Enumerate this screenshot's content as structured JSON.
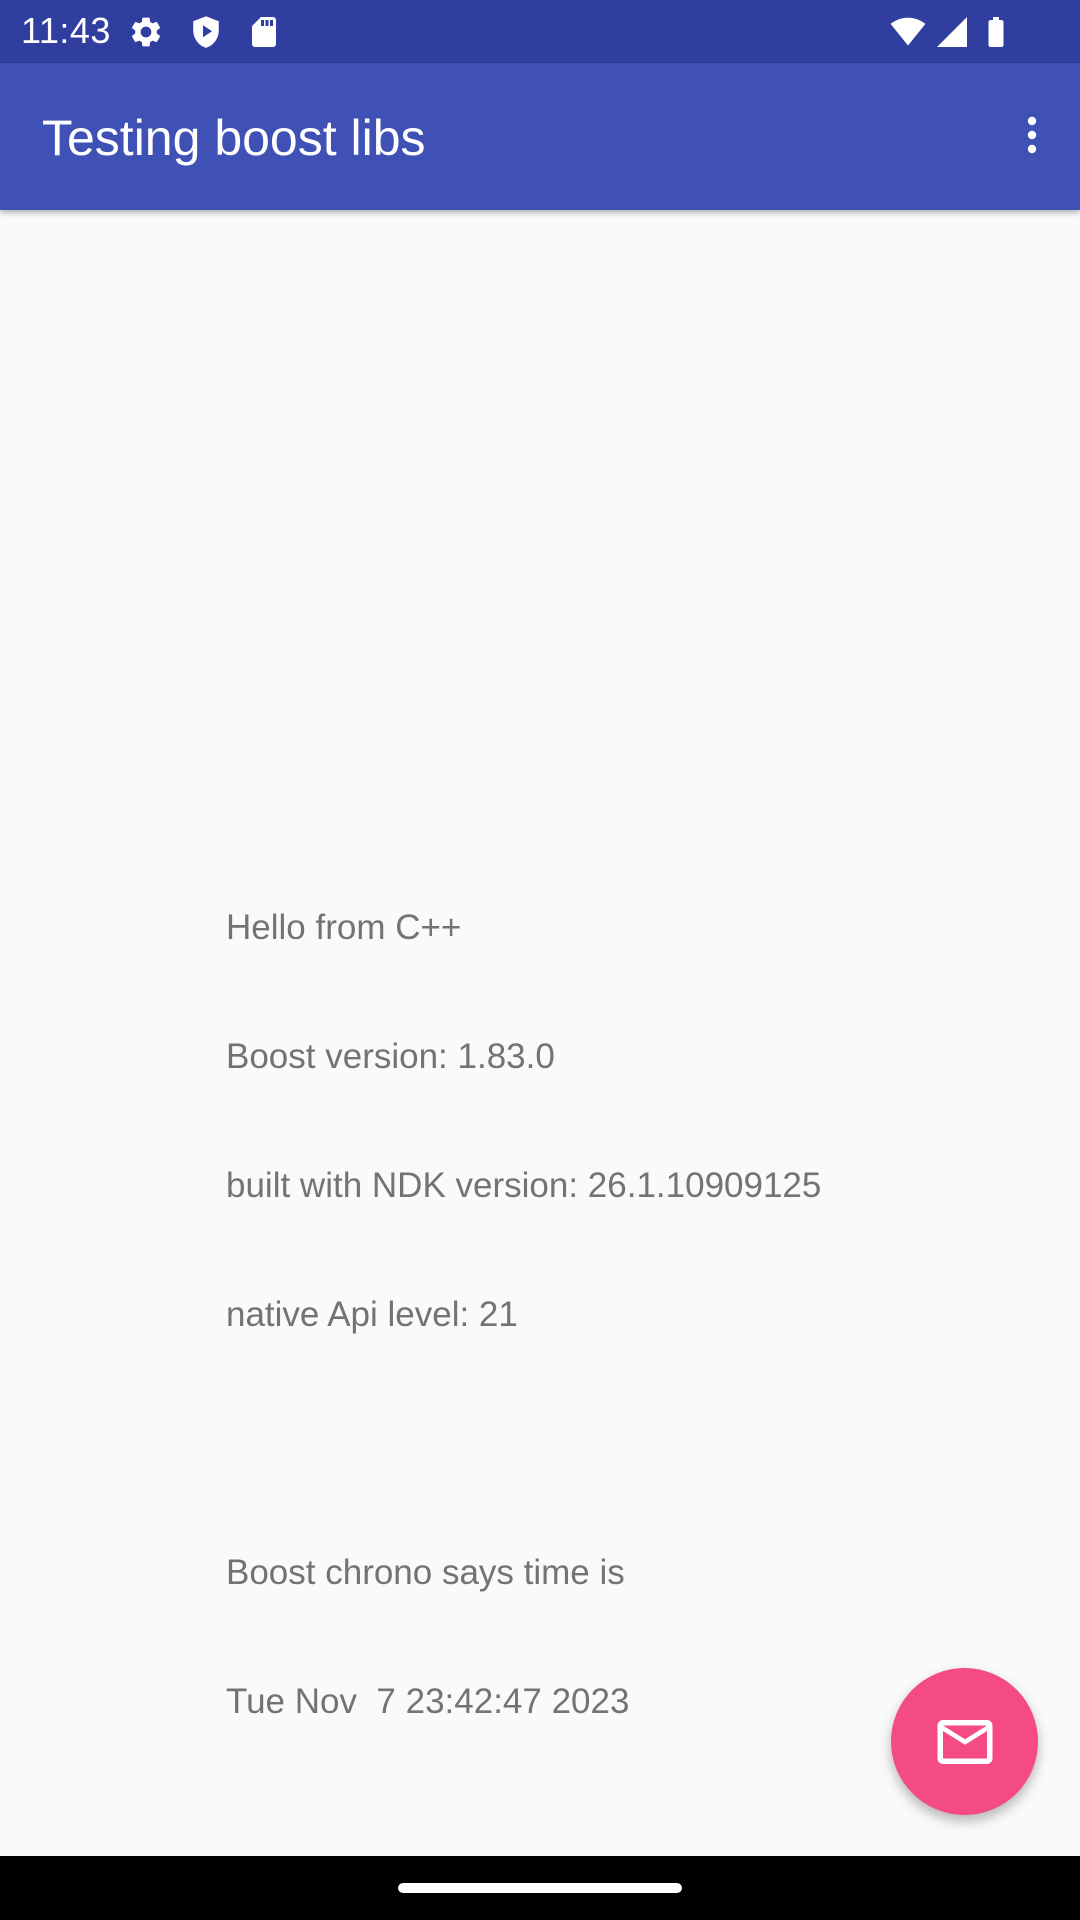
{
  "status_bar": {
    "time": "11:43",
    "icons": [
      "gear-icon",
      "shield-play-icon",
      "sd-card-icon",
      "wifi-icon",
      "signal-icon",
      "battery-icon"
    ]
  },
  "app_bar": {
    "title": "Testing boost libs",
    "menu_icon": "more-vert-icon"
  },
  "content": {
    "lines": [
      "Hello from C++",
      "Boost version: 1.83.0",
      "built with NDK version: 26.1.10909125",
      "native Api level: 21",
      "",
      "Boost chrono says time is",
      "Tue Nov  7 23:42:47 2023"
    ]
  },
  "fab": {
    "icon": "email-icon"
  },
  "colors": {
    "status_bar": "#303f9f",
    "app_bar": "#3f51b5",
    "background": "#fafafa",
    "accent": "#f44a86",
    "body_text": "#737373"
  }
}
